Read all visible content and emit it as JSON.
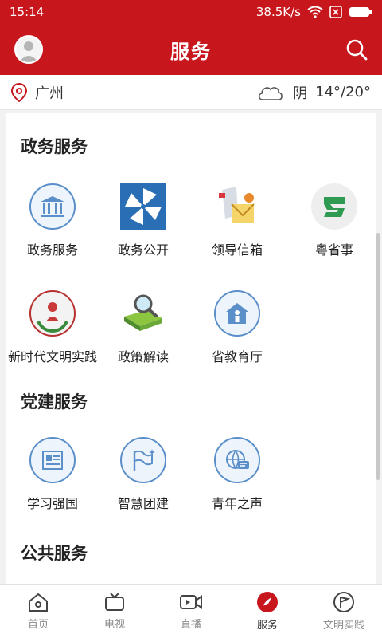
{
  "status_bar": {
    "time": "15:14",
    "speed": "38.5K/s"
  },
  "header": {
    "title": "服务"
  },
  "location": {
    "city": "广州",
    "weather": "阴",
    "temp": "14°/20°"
  },
  "sections": [
    {
      "title": "政务服务",
      "items": [
        "政务服务",
        "政务公开",
        "领导信箱",
        "粤省事",
        "新时代文明实践",
        "政策解读",
        "省教育厅"
      ]
    },
    {
      "title": "党建服务",
      "items": [
        "学习强国",
        "智慧团建",
        "青年之声"
      ]
    },
    {
      "title": "公共服务",
      "items": []
    }
  ],
  "tabs": [
    {
      "label": "首页",
      "icon": "home-icon"
    },
    {
      "label": "电视",
      "icon": "tv-icon"
    },
    {
      "label": "直播",
      "icon": "live-video-icon"
    },
    {
      "label": "服务",
      "icon": "compass-icon",
      "active": true
    },
    {
      "label": "文明实践",
      "icon": "flag-icon"
    }
  ],
  "colors": {
    "brand": "#c8161d",
    "icon_blue": "#5b8fc9"
  }
}
